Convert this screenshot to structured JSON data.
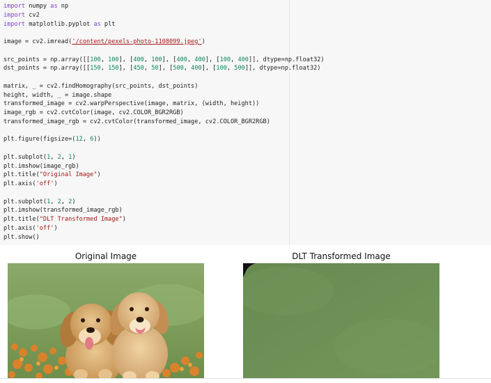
{
  "code_cell": {
    "lines": [
      [
        {
          "t": "import",
          "c": "kw"
        },
        {
          "t": " numpy "
        },
        {
          "t": "as",
          "c": "kw"
        },
        {
          "t": " np"
        }
      ],
      [
        {
          "t": "import",
          "c": "kw"
        },
        {
          "t": " cv2"
        }
      ],
      [
        {
          "t": "import",
          "c": "kw"
        },
        {
          "t": " matplotlib.pyplot "
        },
        {
          "t": "as",
          "c": "kw"
        },
        {
          "t": " plt"
        }
      ],
      [],
      [
        {
          "t": "image = cv2.imread("
        },
        {
          "t": "'/content/pexels-photo-1108099.jpeg'",
          "c": "st url"
        },
        {
          "t": ")"
        }
      ],
      [],
      [
        {
          "t": "src_points = np.array([["
        },
        {
          "t": "100",
          "c": "nm"
        },
        {
          "t": ", "
        },
        {
          "t": "100",
          "c": "nm"
        },
        {
          "t": "], ["
        },
        {
          "t": "400",
          "c": "nm"
        },
        {
          "t": ", "
        },
        {
          "t": "100",
          "c": "nm"
        },
        {
          "t": "], ["
        },
        {
          "t": "400",
          "c": "nm"
        },
        {
          "t": ", "
        },
        {
          "t": "400",
          "c": "nm"
        },
        {
          "t": "], ["
        },
        {
          "t": "100",
          "c": "nm"
        },
        {
          "t": ", "
        },
        {
          "t": "400",
          "c": "nm"
        },
        {
          "t": "]], dtype=np.float32)"
        }
      ],
      [
        {
          "t": "dst_points = np.array([["
        },
        {
          "t": "150",
          "c": "nm"
        },
        {
          "t": ", "
        },
        {
          "t": "150",
          "c": "nm"
        },
        {
          "t": "], ["
        },
        {
          "t": "450",
          "c": "nm"
        },
        {
          "t": ", "
        },
        {
          "t": "50",
          "c": "nm"
        },
        {
          "t": "], ["
        },
        {
          "t": "500",
          "c": "nm"
        },
        {
          "t": ", "
        },
        {
          "t": "400",
          "c": "nm"
        },
        {
          "t": "], ["
        },
        {
          "t": "100",
          "c": "nm"
        },
        {
          "t": ", "
        },
        {
          "t": "500",
          "c": "nm"
        },
        {
          "t": "]], dtype=np.float32)"
        }
      ],
      [],
      [
        {
          "t": "matrix, _ = cv2.findHomography(src_points, dst_points)"
        }
      ],
      [
        {
          "t": "height, width, _ = image.shape"
        }
      ],
      [
        {
          "t": "transformed_image = cv2.warpPerspective(image, matrix, (width, height))"
        }
      ],
      [
        {
          "t": "image_rgb = cv2.cvtColor(image, cv2.COLOR_BGR2RGB)"
        }
      ],
      [
        {
          "t": "transformed_image_rgb = cv2.cvtColor(transformed_image, cv2.COLOR_BGR2RGB)"
        }
      ],
      [],
      [
        {
          "t": "plt.figure(figsize=("
        },
        {
          "t": "12",
          "c": "nm"
        },
        {
          "t": ", "
        },
        {
          "t": "6",
          "c": "nm"
        },
        {
          "t": "))"
        }
      ],
      [],
      [
        {
          "t": "plt.subplot("
        },
        {
          "t": "1",
          "c": "nm"
        },
        {
          "t": ", "
        },
        {
          "t": "2",
          "c": "nm"
        },
        {
          "t": ", "
        },
        {
          "t": "1",
          "c": "nm"
        },
        {
          "t": ")"
        }
      ],
      [
        {
          "t": "plt.imshow(image_rgb)"
        }
      ],
      [
        {
          "t": "plt.title("
        },
        {
          "t": "\"Original Image\"",
          "c": "st"
        },
        {
          "t": ")"
        }
      ],
      [
        {
          "t": "plt.axis("
        },
        {
          "t": "'off'",
          "c": "st"
        },
        {
          "t": ")"
        }
      ],
      [],
      [
        {
          "t": "plt.subplot("
        },
        {
          "t": "1",
          "c": "nm"
        },
        {
          "t": ", "
        },
        {
          "t": "2",
          "c": "nm"
        },
        {
          "t": ", "
        },
        {
          "t": "2",
          "c": "nm"
        },
        {
          "t": ")"
        }
      ],
      [
        {
          "t": "plt.imshow(transformed_image_rgb)"
        }
      ],
      [
        {
          "t": "plt.title("
        },
        {
          "t": "\"DLT Transformed Image\"",
          "c": "st"
        },
        {
          "t": ")"
        }
      ],
      [
        {
          "t": "plt.axis("
        },
        {
          "t": "'off'",
          "c": "st"
        },
        {
          "t": ")"
        }
      ],
      [
        {
          "t": "plt.show()"
        }
      ]
    ]
  },
  "output": {
    "left_title": "Original Image",
    "right_title": "DLT Transformed Image"
  },
  "colors": {
    "keyword": "#7d3fd0",
    "string": "#a31515",
    "number": "#098658",
    "grass": "#7f9e5c",
    "transformed_fill": "#6b8e55"
  }
}
